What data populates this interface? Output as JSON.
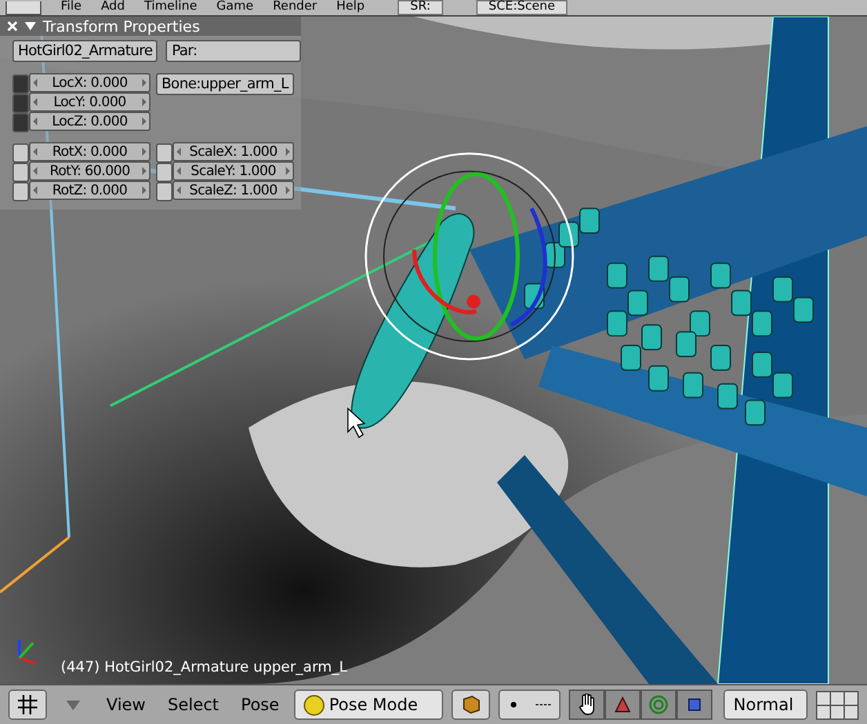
{
  "menu_bar": {
    "items": [
      "File",
      "Add",
      "Timeline",
      "Game",
      "Render",
      "Help"
    ],
    "screen": "SR:",
    "scene": "SCE:Scene"
  },
  "transform_panel": {
    "title": "Transform Properties",
    "object_name": "HotGirl02_Armature",
    "parent": "Par:",
    "bone": "Bone:upper_arm_L",
    "location": [
      {
        "label": "LocX: 0.000",
        "locked": true
      },
      {
        "label": "LocY: 0.000",
        "locked": true
      },
      {
        "label": "LocZ: 0.000",
        "locked": true
      }
    ],
    "rotation": [
      {
        "label": "RotX: 0.000",
        "locked": false
      },
      {
        "label": "RotY: 60.000",
        "locked": false
      },
      {
        "label": "RotZ: 0.000",
        "locked": false
      }
    ],
    "scale": [
      {
        "label": "ScaleX: 1.000",
        "locked": false
      },
      {
        "label": "ScaleY: 1.000",
        "locked": false
      },
      {
        "label": "ScaleZ: 1.000",
        "locked": false
      }
    ]
  },
  "viewport": {
    "status": "(447) HotGirl02_Armature upper_arm_L"
  },
  "header": {
    "menus": [
      "View",
      "Select",
      "Pose"
    ],
    "mode": "Pose Mode",
    "transform_orientation": "Normal"
  }
}
